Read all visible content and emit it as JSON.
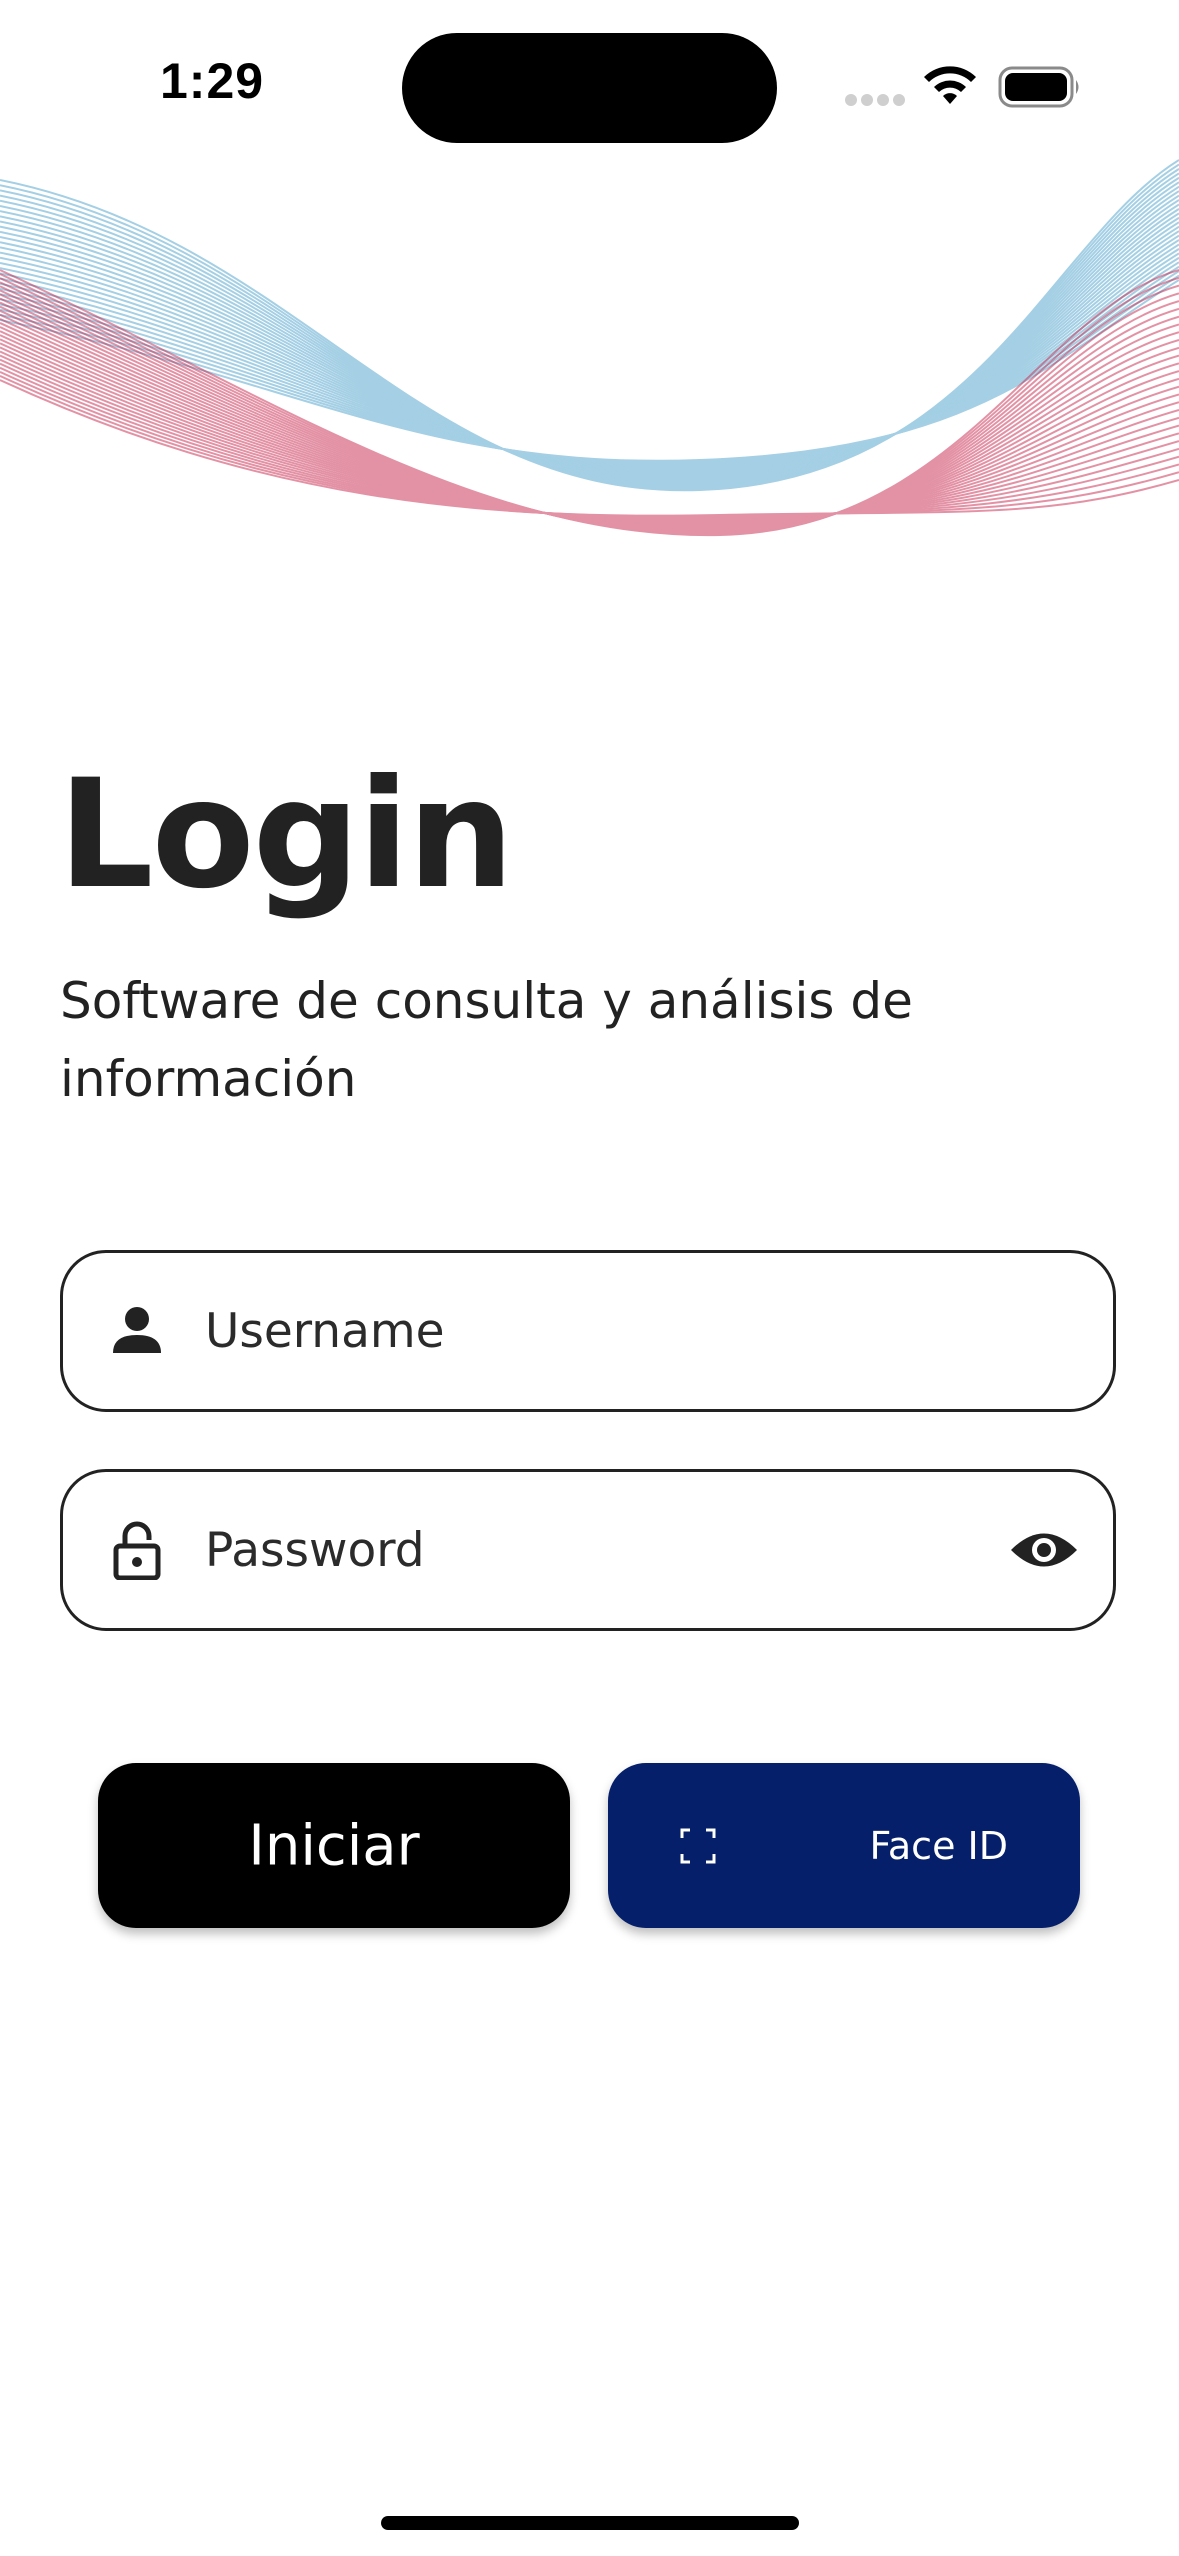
{
  "status_bar": {
    "time": "1:29",
    "icons": [
      "signal-icon",
      "wifi-icon",
      "battery-icon"
    ]
  },
  "login": {
    "title": "Login",
    "subtitle": "Software de consulta y análisis de información"
  },
  "username_field": {
    "placeholder": "Username",
    "value": "",
    "icon": "person-icon"
  },
  "password_field": {
    "placeholder": "Password",
    "value": "",
    "icon": "lock-icon",
    "toggle_icon": "eye-icon"
  },
  "buttons": {
    "login_label": "Iniciar",
    "faceid_label": "Face ID",
    "faceid_icon": "face-id-icon"
  },
  "colors": {
    "text": "#222222",
    "login_button": "#000000",
    "faceid_button": "#051f6b",
    "wave_blue": "#5aa9cf",
    "wave_red": "#c8284e"
  }
}
